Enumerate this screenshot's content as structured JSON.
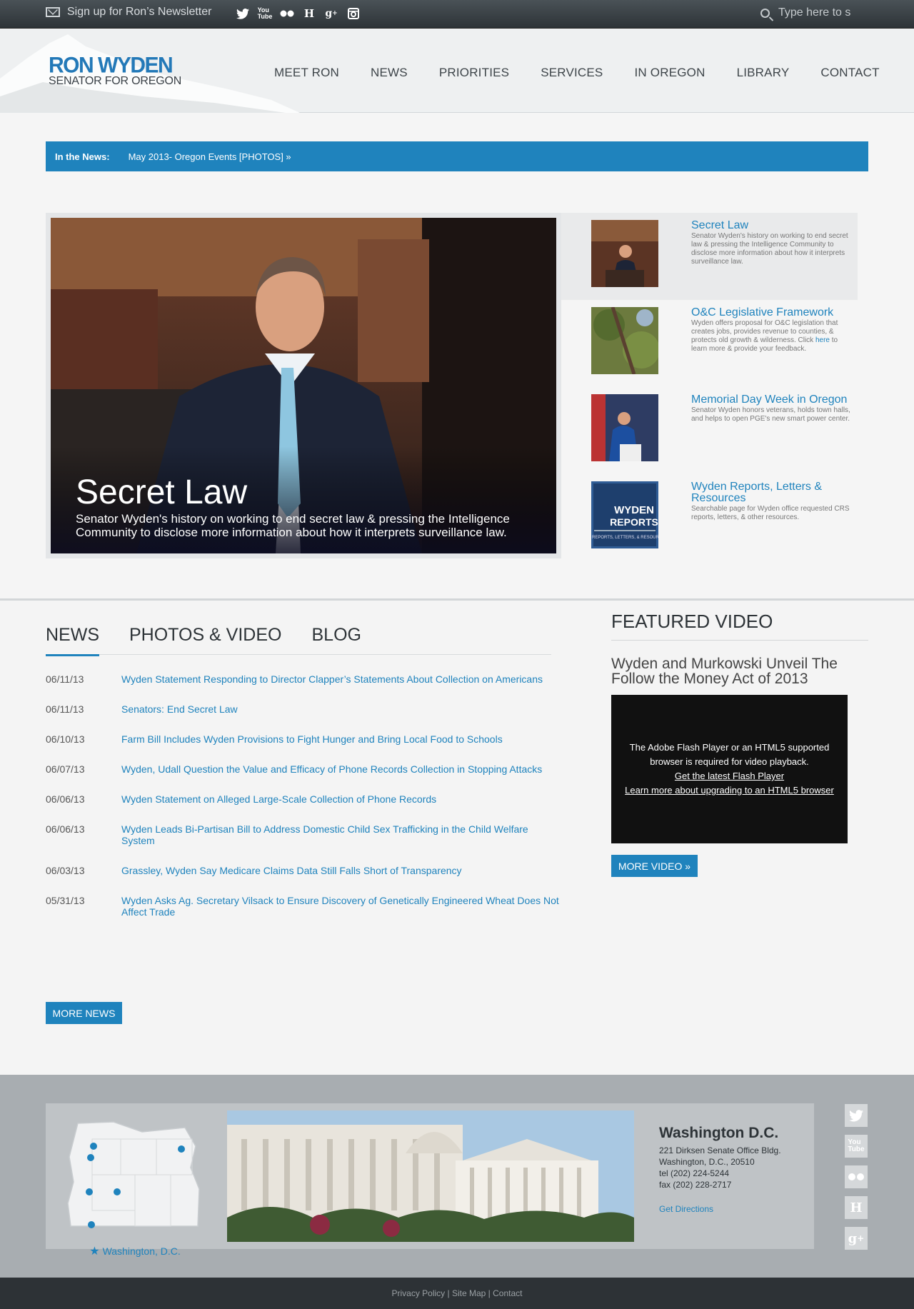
{
  "topbar": {
    "newsletter": "Sign up for Ron’s Newsletter",
    "social_icons": [
      "twitter-icon",
      "youtube-icon",
      "flickr-icon",
      "houzz-icon",
      "google-plus-icon",
      "instagram-icon"
    ],
    "search_placeholder": "Type here to s"
  },
  "header": {
    "logo_name": "RON WYDEN",
    "logo_sub": "SENATOR FOR OREGON",
    "nav": [
      "MEET RON",
      "NEWS",
      "PRIORITIES",
      "SERVICES",
      "IN OREGON",
      "LIBRARY",
      "CONTACT"
    ]
  },
  "ticker": {
    "label": "In the News:",
    "text": "May 2013- Oregon Events [PHOTOS] »"
  },
  "hero": {
    "title": "Secret Law",
    "desc": "Senator Wyden's history on working to end secret law & pressing the Intelligence Community to disclose more information about how it interprets surveillance law."
  },
  "side_items": [
    {
      "title": "Secret Law",
      "desc": "Senator Wyden's history on working to end secret law & pressing the Intelligence Community to disclose more information about how it interprets surveillance law."
    },
    {
      "title": "O&C Legislative Framework",
      "desc": "Wyden offers proposal for O&C legislation that creates jobs, provides revenue to counties, & protects old growth & wilderness. Click",
      "link": "here",
      "desc2": "to learn more & provide your feedback."
    },
    {
      "title": "Memorial Day Week in Oregon",
      "desc": "Senator Wyden honors veterans, holds town halls, and helps to open PGE's new smart power center."
    },
    {
      "title": "Wyden Reports, Letters & Resources",
      "desc": "Searchable page for Wyden office requested CRS reports, letters, & other resources."
    }
  ],
  "tabs": [
    "NEWS",
    "PHOTOS & VIDEO",
    "BLOG"
  ],
  "news": [
    {
      "date": "06/11/13",
      "headline": "Wyden Statement Responding to Director Clapper’s Statements About Collection on Americans"
    },
    {
      "date": "06/11/13",
      "headline": "Senators: End Secret Law"
    },
    {
      "date": "06/10/13",
      "headline": "Farm Bill Includes Wyden Provisions to Fight Hunger and Bring Local Food to Schools"
    },
    {
      "date": "06/07/13",
      "headline": "Wyden, Udall Question the Value and Efficacy of Phone Records Collection in Stopping Attacks"
    },
    {
      "date": "06/06/13",
      "headline": "Wyden Statement on Alleged Large-Scale Collection of Phone Records"
    },
    {
      "date": "06/06/13",
      "headline": "Wyden Leads Bi-Partisan Bill to Address Domestic Child Sex Trafficking in the Child Welfare System"
    },
    {
      "date": "06/03/13",
      "headline": "Grassley, Wyden Say Medicare Claims Data Still Falls Short of Transparency"
    },
    {
      "date": "05/31/13",
      "headline": "Wyden Asks Ag. Secretary Vilsack to Ensure Discovery of Genetically Engineered Wheat Does Not Affect Trade"
    }
  ],
  "more_news": "MORE NEWS",
  "featured": {
    "heading": "FEATURED VIDEO",
    "title": "Wyden and Murkowski Unveil The Follow the Money Act of 2013",
    "player_msg": "The Adobe Flash Player or an HTML5 supported browser is required for video playback.",
    "player_link1": "Get the latest Flash Player",
    "player_link2": "Learn more about upgrading to an HTML5 browser",
    "more_video": "MORE VIDEO »"
  },
  "footer": {
    "map_label": "Washington, D.C.",
    "office": "Washington D.C.",
    "addr1": "221 Dirksen Senate Office Bldg.",
    "addr2": "Washington, D.C., 20510",
    "tel": "tel (202) 224-5244",
    "fax": "fax (202) 228-2717",
    "directions": "Get Directions",
    "social_icons": [
      "twitter-icon",
      "youtube-icon",
      "flickr-icon",
      "houzz-icon",
      "google-plus-icon"
    ]
  },
  "bottom": {
    "links": [
      "Privacy Policy",
      "Site Map",
      "Contact"
    ],
    "sep": " | "
  },
  "colors": {
    "accent": "#1f83bd",
    "topbar": "#3a4146",
    "footer": "#a8adb1"
  }
}
